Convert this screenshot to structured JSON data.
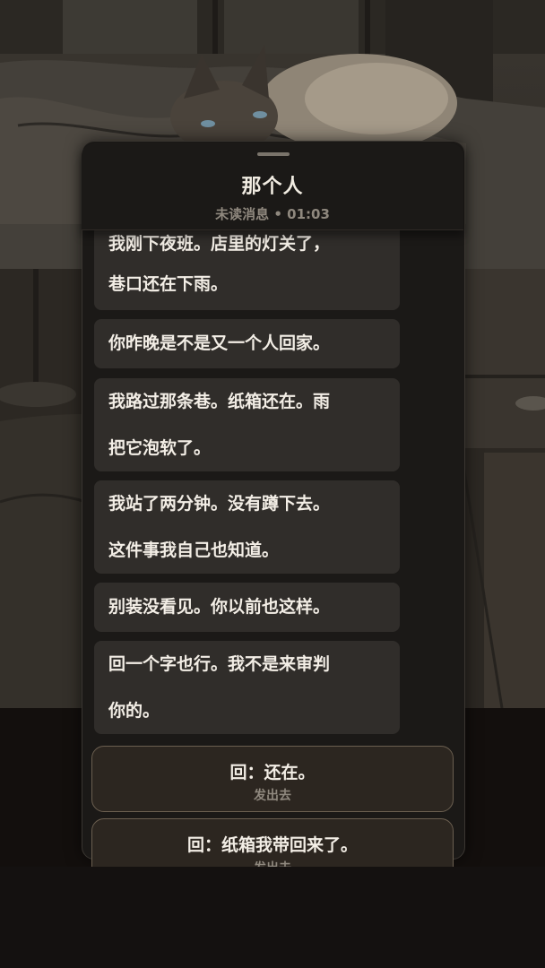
{
  "header": {
    "title": "那个人",
    "subtitle": "未读消息 • 01:03"
  },
  "messages": [
    {
      "lines": [
        "我刚下夜班。店里的灯关了，",
        "巷口还在下雨。"
      ]
    },
    {
      "lines": [
        "你昨晚是不是又一个人回家。"
      ]
    },
    {
      "lines": [
        "我路过那条巷。纸箱还在。雨",
        "把它泡软了。"
      ]
    },
    {
      "lines": [
        "我站了两分钟。没有蹲下去。",
        "这件事我自己也知道。"
      ]
    },
    {
      "lines": [
        "别装没看见。你以前也这样。"
      ]
    },
    {
      "lines": [
        "回一个字也行。我不是来审判",
        "你的。"
      ]
    }
  ],
  "choices": [
    {
      "text": "回：还在。",
      "action": "发出去"
    },
    {
      "text": "回：纸箱我带回来了。",
      "action": "发出去"
    }
  ],
  "colors": {
    "panel": "#1b1917",
    "bubble": "#302d2a",
    "choice_border": "#6b5f50",
    "text": "#f3eee6",
    "muted": "#8f887e"
  }
}
